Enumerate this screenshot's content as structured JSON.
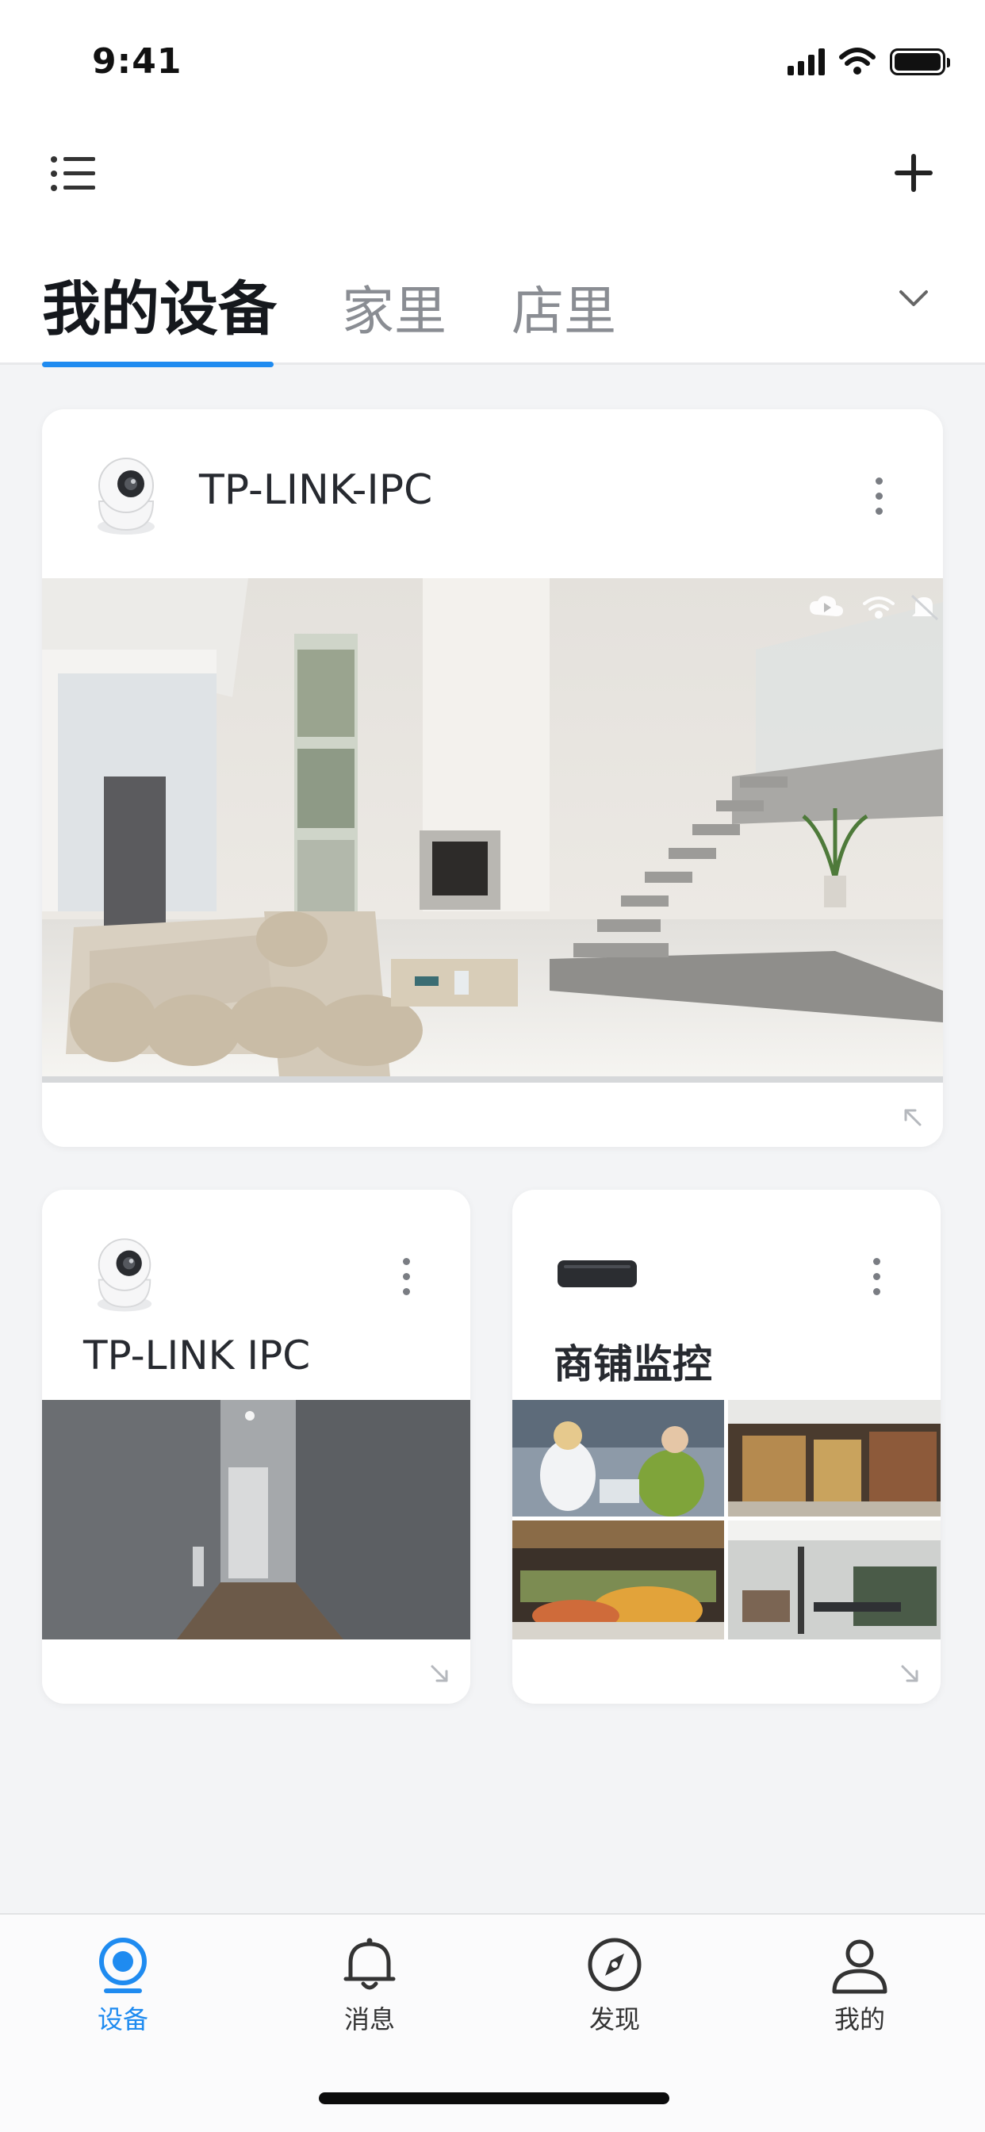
{
  "status_bar": {
    "time": "9:41"
  },
  "header": {
    "tabs": [
      {
        "label": "我的设备",
        "active": true
      },
      {
        "label": "家里",
        "active": false
      },
      {
        "label": "店里",
        "active": false
      }
    ]
  },
  "devices": [
    {
      "name": "TP-LINK-IPC",
      "type": "camera",
      "status_icons": [
        "cloud-icon",
        "wifi-icon",
        "mute-icon"
      ]
    },
    {
      "name": "TP-LINK IPC",
      "type": "camera"
    },
    {
      "name": "商铺监控",
      "type": "nvr"
    }
  ],
  "bottom_nav": [
    {
      "label": "设备",
      "icon": "device-icon",
      "active": true
    },
    {
      "label": "消息",
      "icon": "bell-icon",
      "active": false
    },
    {
      "label": "发现",
      "icon": "compass-icon",
      "active": false
    },
    {
      "label": "我的",
      "icon": "person-icon",
      "active": false
    }
  ],
  "colors": {
    "accent": "#1f8bf0",
    "background": "#f3f4f6",
    "card": "#ffffff"
  }
}
